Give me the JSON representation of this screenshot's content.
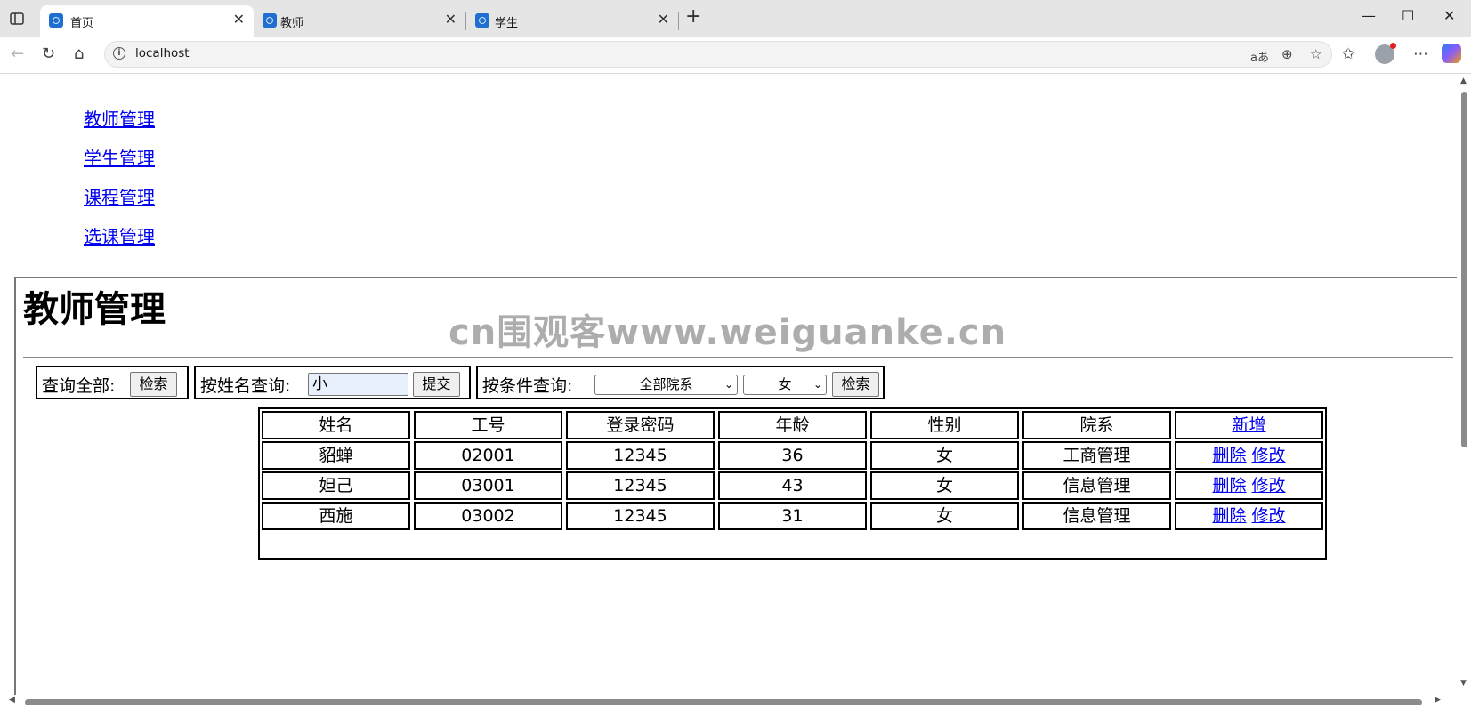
{
  "browser": {
    "tabs": [
      {
        "title": "首页",
        "active": true
      },
      {
        "title": "教师",
        "active": false
      },
      {
        "title": "学生",
        "active": false
      }
    ],
    "url": "localhost",
    "read_aloud_label": "aあ"
  },
  "menu": {
    "items": [
      "教师管理",
      "学生管理",
      "课程管理",
      "选课管理"
    ]
  },
  "page": {
    "title": "教师管理",
    "watermark": "cn围观客www.weiguanke.cn"
  },
  "query_all": {
    "label": "查询全部:",
    "button": "检索"
  },
  "query_name": {
    "label": "按姓名查询:",
    "value": "小",
    "button": "提交"
  },
  "query_cond": {
    "label": "按条件查询:",
    "dept_selected": "全部院系",
    "gender_selected": "女",
    "button": "检索"
  },
  "table": {
    "headers": [
      "姓名",
      "工号",
      "登录密码",
      "年龄",
      "性别",
      "院系"
    ],
    "add_label": "新增",
    "delete_label": "删除",
    "edit_label": "修改",
    "rows": [
      [
        "貂蝉",
        "02001",
        "12345",
        "36",
        "女",
        "工商管理"
      ],
      [
        "妲己",
        "03001",
        "12345",
        "43",
        "女",
        "信息管理"
      ],
      [
        "西施",
        "03002",
        "12345",
        "31",
        "女",
        "信息管理"
      ]
    ]
  },
  "colors": {
    "link": "#0000ee",
    "input_autofill": "#e8f0fe",
    "tabbar": "#e5e5e5"
  }
}
